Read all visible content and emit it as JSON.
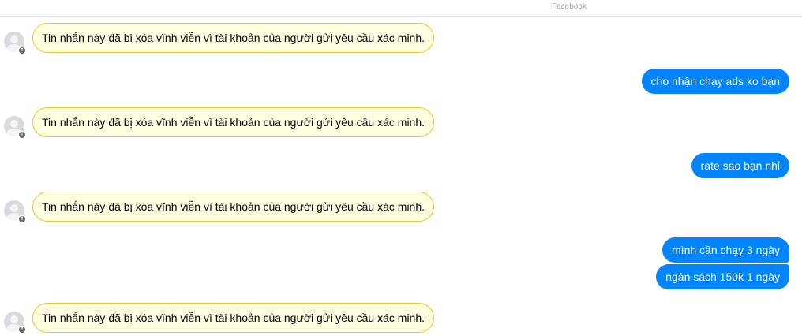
{
  "header": {
    "source_label": "Facebook"
  },
  "conversation": {
    "incoming": [
      {
        "text": "Tin nhắn này đã bị xóa vĩnh viễn vì tài khoản của người gửi yêu cầu xác minh.",
        "avatar_icon": "default-profile-icon",
        "badge_icon": "facebook-badge-icon"
      },
      {
        "text": "Tin nhắn này đã bị xóa vĩnh viễn vì tài khoản của người gửi yêu cầu xác minh.",
        "avatar_icon": "default-profile-icon",
        "badge_icon": "facebook-badge-icon"
      },
      {
        "text": "Tin nhắn này đã bị xóa vĩnh viễn vì tài khoản của người gửi yêu cầu xác minh.",
        "avatar_icon": "default-profile-icon",
        "badge_icon": "facebook-badge-icon"
      },
      {
        "text": "Tin nhắn này đã bị xóa vĩnh viễn vì tài khoản của người gửi yêu cầu xác minh.",
        "avatar_icon": "default-profile-icon",
        "badge_icon": "facebook-badge-icon"
      }
    ],
    "outgoing": [
      {
        "text": "cho nhận chạy ads ko bạn"
      },
      {
        "text": "rate sao bạn nhỉ"
      },
      {
        "text": "mình cần chạy 3 ngày"
      },
      {
        "text": "ngân sách 150k 1 ngày"
      }
    ]
  },
  "colors": {
    "outgoing_bubble": "#0084ff",
    "deleted_bubble_bg": "#fefde0",
    "deleted_bubble_border": "#e8c62e"
  }
}
